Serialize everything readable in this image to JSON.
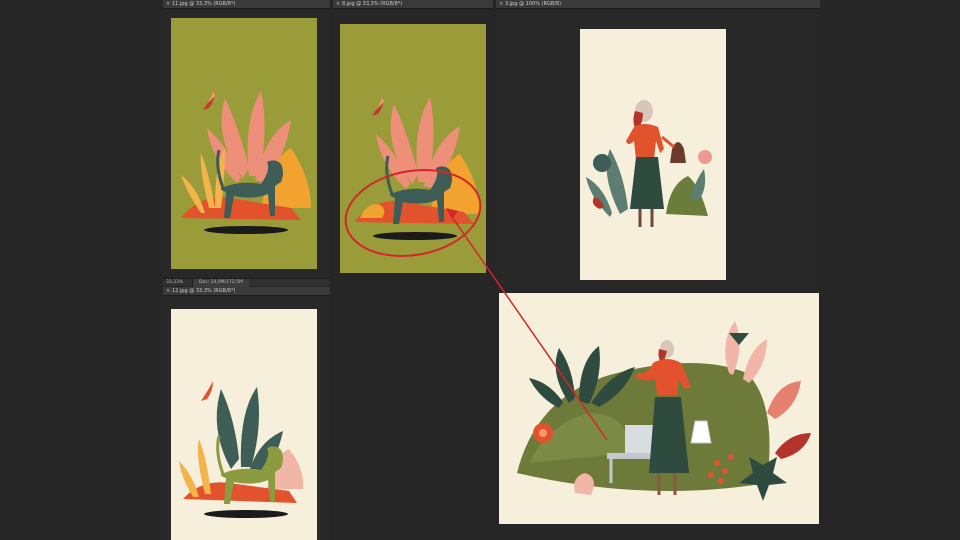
{
  "documents": {
    "doc1": {
      "title": "11.jpg @ 33,3% (RGB/8*)",
      "close": "×"
    },
    "doc2": {
      "title": "8.jpg @ 33,3% (RGB/8*)",
      "close": "×"
    },
    "doc3": {
      "title": "3.jpg @ 100% (RGB/8)",
      "close": "×"
    },
    "doc4": {
      "title": "12.jpg @ 33,3% (RGB/8*)",
      "close": "×"
    }
  },
  "statusbar": {
    "zoom": "33,33%",
    "docinfo": "Doc: 24,9M/172,5M"
  },
  "colors": {
    "olive": "#9a9c3a",
    "cream": "#f5efdc",
    "annotation_red": "#d6252a",
    "dog_teal": "#3e5d57",
    "dog_olive": "#8c9a40",
    "pink": "#ee8f7a",
    "orange": "#f2a22e",
    "red_orange": "#e2522c"
  },
  "icons": [
    "close-icon",
    "annotation-circle",
    "annotation-arrow"
  ]
}
